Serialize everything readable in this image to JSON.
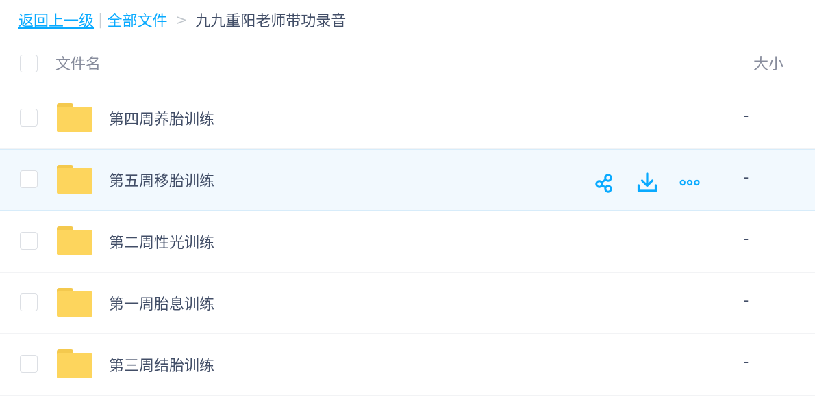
{
  "breadcrumb": {
    "back_label": "返回上一级",
    "separator": "|",
    "parent_label": "全部文件",
    "arrow": ">",
    "current_label": "九九重阳老师带功录音"
  },
  "header": {
    "name_label": "文件名",
    "size_label": "大小"
  },
  "rows": [
    {
      "name": "第四周养胎训练",
      "size": "-",
      "type": "folder"
    },
    {
      "name": "第五周移胎训练",
      "size": "-",
      "type": "folder",
      "hovered": true
    },
    {
      "name": "第二周性光训练",
      "size": "-",
      "type": "folder"
    },
    {
      "name": "第一周胎息训练",
      "size": "-",
      "type": "folder"
    },
    {
      "name": "第三周结胎训练",
      "size": "-",
      "type": "folder"
    }
  ],
  "row_actions": [
    "share-icon",
    "download-icon",
    "more-icon"
  ],
  "colors": {
    "accent": "#09aaff",
    "text": "#424e67",
    "muted": "#878c9c",
    "folder": "#fdd55d",
    "hover_bg": "#f2f9fe"
  }
}
